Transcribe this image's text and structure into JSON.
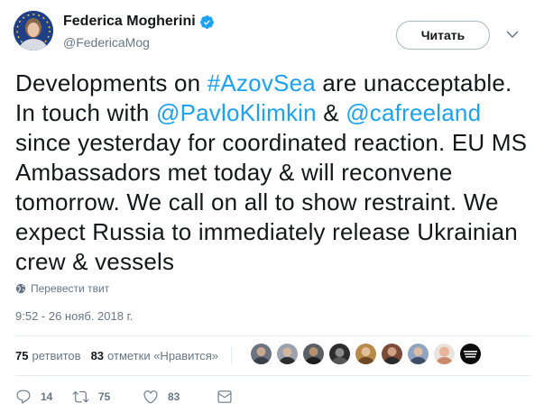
{
  "author": {
    "name": "Federica Mogherini",
    "handle": "@FedericaMog",
    "verified": true,
    "avatar_icon": "profile-photo"
  },
  "follow_button": {
    "label": "Читать"
  },
  "menu_icon": "chevron-down-icon",
  "tweet": {
    "segments": [
      {
        "text": "Developments on ",
        "type": "text"
      },
      {
        "text": "#AzovSea",
        "type": "hashtag"
      },
      {
        "text": " are unacceptable. In touch with ",
        "type": "text"
      },
      {
        "text": "@PavloKlimkin",
        "type": "mention"
      },
      {
        "text": " & ",
        "type": "text"
      },
      {
        "text": "@cafreeland",
        "type": "mention"
      },
      {
        "text": " since yesterday for coordinated reaction. EU MS Ambassadors met today & will reconvene tomorrow. We call on all to show restraint. We expect Russia to immediately release Ukrainian crew & vessels",
        "type": "text"
      }
    ],
    "link_color": "#1da1f2"
  },
  "translate": {
    "label": "Перевести твит"
  },
  "timestamp": "9:52 - 26 нояб. 2018 г.",
  "stats": {
    "retweets_count": "75",
    "retweets_label": "ретвитов",
    "likes_count": "83",
    "likes_label": "отметки «Нравится»"
  },
  "likers_count_shown": 9,
  "actions": {
    "replies": "14",
    "retweets": "75",
    "likes": "83"
  },
  "colors": {
    "text": "#14171a",
    "secondary": "#657786",
    "accent": "#1da1f2",
    "verified": "#1da1f2",
    "divider": "#e6ecf0"
  }
}
